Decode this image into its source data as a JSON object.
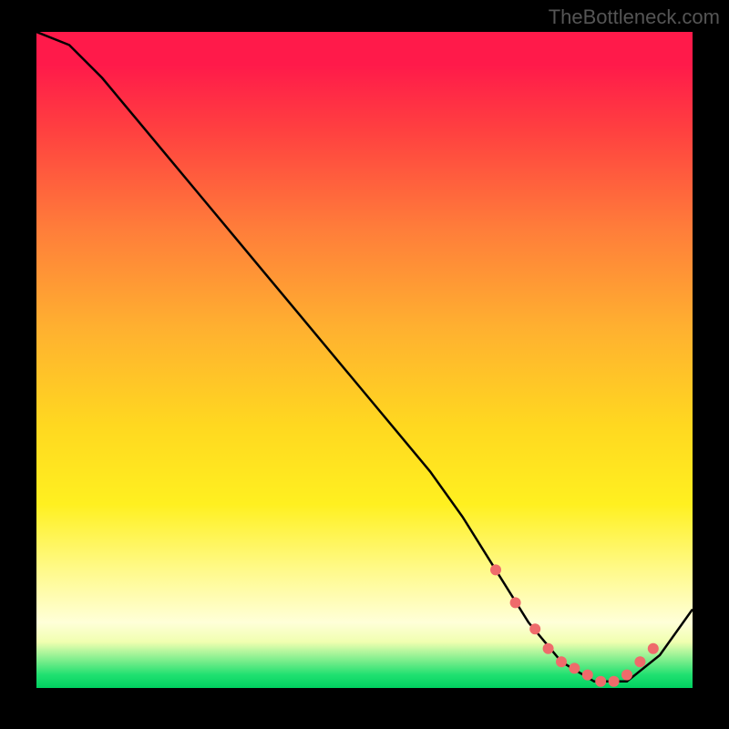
{
  "watermark": "TheBottleneck.com",
  "chart_data": {
    "type": "line",
    "title": "",
    "xlabel": "",
    "ylabel": "",
    "xlim": [
      0,
      100
    ],
    "ylim": [
      0,
      100
    ],
    "series": [
      {
        "name": "bottleneck-curve",
        "x": [
          0,
          5,
          10,
          15,
          20,
          25,
          30,
          35,
          40,
          45,
          50,
          55,
          60,
          65,
          70,
          75,
          80,
          85,
          90,
          95,
          100
        ],
        "values": [
          100,
          98,
          93,
          87,
          81,
          75,
          69,
          63,
          57,
          51,
          45,
          39,
          33,
          26,
          18,
          10,
          4,
          1,
          1,
          5,
          12
        ]
      }
    ],
    "markers": {
      "name": "optimal-region-dots",
      "x": [
        70,
        73,
        76,
        78,
        80,
        82,
        84,
        86,
        88,
        90,
        92,
        94
      ],
      "values": [
        18,
        13,
        9,
        6,
        4,
        3,
        2,
        1,
        1,
        2,
        4,
        6
      ]
    },
    "gradient_stops": [
      {
        "pct": 0,
        "color": "#ff1a4a"
      },
      {
        "pct": 30,
        "color": "#ff7d3a"
      },
      {
        "pct": 60,
        "color": "#ffd820"
      },
      {
        "pct": 90,
        "color": "#ffffd8"
      },
      {
        "pct": 100,
        "color": "#00d060"
      }
    ]
  }
}
